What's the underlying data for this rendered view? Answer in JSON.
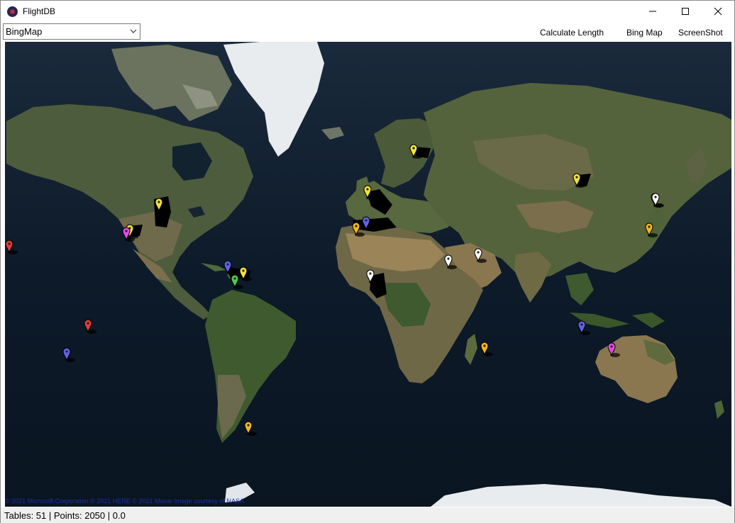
{
  "window": {
    "title": "FlightDB",
    "controls": [
      "minimize-icon",
      "maximize-icon",
      "close-icon"
    ]
  },
  "toolbar": {
    "map_provider": {
      "selected": "BingMap"
    },
    "menu": {
      "calculate_length": "Calculate Length",
      "bing_map": "Bing Map",
      "screenshot": "ScreenShot"
    }
  },
  "map": {
    "attribution": "© 2021 Microsoft Corporation  © 2021 HERE  © 2021 Maxar  Image courtesy of NASA",
    "pin_colors": {
      "yellow": "#f2e23a",
      "white": "#ffffff",
      "orange": "#f3b51b",
      "blue": "#6262e8",
      "red": "#e23b3b",
      "green": "#4fc94f",
      "magenta": "#e24ce0"
    },
    "pins": [
      {
        "color": "red"
      },
      {
        "color": "white"
      },
      {
        "color": "yellow"
      },
      {
        "color": "magenta"
      },
      {
        "color": "yellow"
      },
      {
        "color": "blue"
      },
      {
        "color": "yellow"
      },
      {
        "color": "green"
      },
      {
        "color": "red"
      },
      {
        "color": "blue"
      },
      {
        "color": "orange"
      },
      {
        "color": "yellow"
      },
      {
        "color": "yellow"
      },
      {
        "color": "orange"
      },
      {
        "color": "blue"
      },
      {
        "color": "white"
      },
      {
        "color": "white"
      },
      {
        "color": "white"
      },
      {
        "color": "yellow"
      },
      {
        "color": "white"
      },
      {
        "color": "orange"
      },
      {
        "color": "blue"
      },
      {
        "color": "magenta"
      },
      {
        "color": "orange"
      }
    ]
  },
  "status": {
    "text": "Tables: 51  |  Points: 2050  |  0.0"
  }
}
